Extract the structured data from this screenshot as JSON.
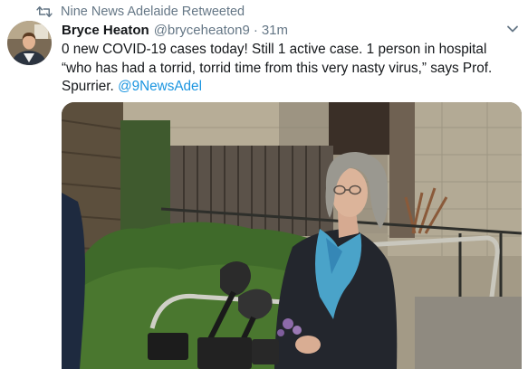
{
  "retweet": {
    "label": "Nine News Adelaide Retweeted",
    "icon": "retweet-icon"
  },
  "tweet": {
    "author_name": "Bryce Heaton",
    "author_handle": "@bryceheaton9",
    "separator": "·",
    "time": "31m",
    "text_main": "0 new COVID-19 cases today! Still 1 active case. 1 person in hospital “who has had a torrid, torrid time from this very nasty virus,” says Prof. Spurrier.",
    "mention": "@9NewsAdel"
  },
  "icons": {
    "menu": "chevron-down-icon",
    "avatar": "avatar"
  },
  "colors": {
    "link": "#1b95e0",
    "secondary_text": "#657786",
    "primary_text": "#14171a"
  }
}
